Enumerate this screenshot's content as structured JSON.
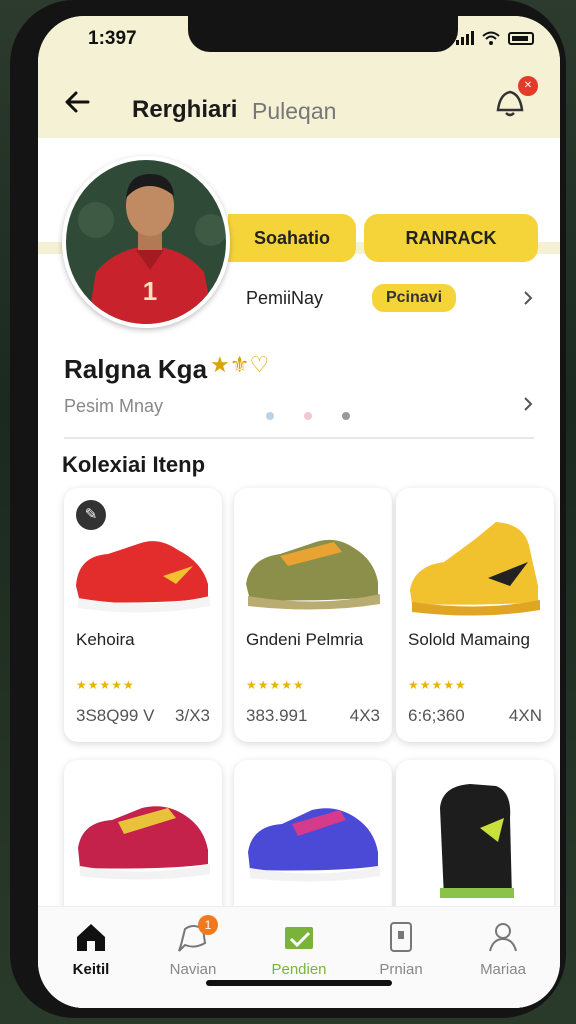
{
  "status": {
    "time": "1:397"
  },
  "header": {
    "title": "Rerghiari",
    "subtitle": "Puleqan",
    "notification_count": ""
  },
  "profile": {
    "tab_left": "Soahatio",
    "tab_right": "RANRACK",
    "row_label": "PemiiNay",
    "row_pill": "Pcinavi",
    "name": "Ralgna Kga",
    "name_badge": "★⚜♡",
    "subtitle": "Pesim Mnay",
    "jersey_number": "1"
  },
  "section": {
    "title": "Kolexiai Itenp"
  },
  "products": [
    {
      "name": "Kehoira",
      "rating": "★★★★★",
      "price": "3S8Q99 V",
      "size": "3/X3",
      "color": "#e32d2d"
    },
    {
      "name": "Gndeni Pelmria",
      "rating": "★★★★★",
      "price": "383.991",
      "size": "4X3",
      "color": "#8c8f4a"
    },
    {
      "name": "Solold Mamaing",
      "rating": "★★★★★",
      "price": "6:6;360",
      "size": "4XN",
      "color": "#f2c12e"
    },
    {
      "name": "",
      "rating": "",
      "price": "",
      "size": "",
      "color": "#c4224a"
    },
    {
      "name": "",
      "rating": "",
      "price": "",
      "size": "",
      "color": "#4a4ad6"
    },
    {
      "name": "",
      "rating": "",
      "price": "",
      "size": "",
      "color": "#1d1d1d"
    }
  ],
  "nav": [
    {
      "label": "Keitil",
      "icon": "home-icon",
      "active": true
    },
    {
      "label": "Navian",
      "icon": "chat-icon",
      "badge": "1"
    },
    {
      "label": "Pendien",
      "icon": "card-icon"
    },
    {
      "label": "Prnian",
      "icon": "device-icon"
    },
    {
      "label": "Mariaa",
      "icon": "profile-icon"
    }
  ],
  "colors": {
    "accent": "#f5d43a",
    "header_bg": "#f4f1d4",
    "nav_active": "#111111",
    "nav_green": "#7ab33a"
  }
}
